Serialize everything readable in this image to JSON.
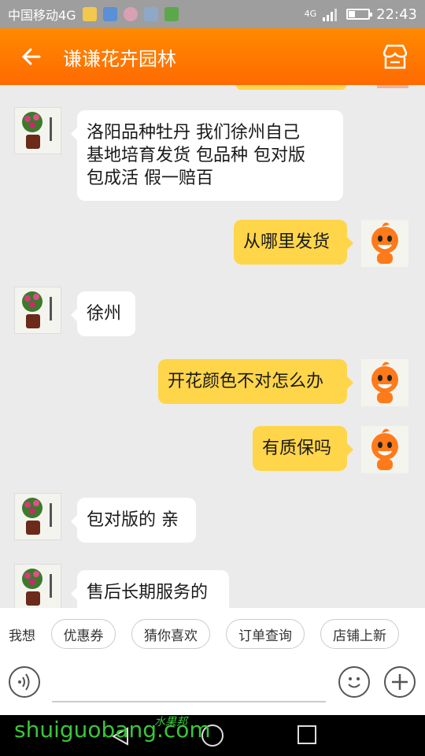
{
  "status": {
    "carrier": "中国移动4G",
    "network": "4G",
    "time": "22:43"
  },
  "header": {
    "title": "谦谦花卉园林"
  },
  "messages": [
    {
      "side": "left",
      "lines": [
        "洛阳品种牡丹  我们徐州自己",
        "基地培育发货  包品种  包对版",
        "包成活   假一赔百"
      ]
    },
    {
      "side": "right",
      "lines": [
        "从哪里发货"
      ]
    },
    {
      "side": "left",
      "lines": [
        "徐州"
      ]
    },
    {
      "side": "right",
      "lines": [
        "开花颜色不对怎么办"
      ]
    },
    {
      "side": "right",
      "lines": [
        "有质保吗"
      ]
    },
    {
      "side": "left",
      "lines": [
        "包对版的 亲"
      ]
    },
    {
      "side": "left",
      "lines": [
        "售后长期服务的"
      ]
    }
  ],
  "quick_reply": {
    "label": "我想",
    "chips": [
      "优惠券",
      "猜你喜欢",
      "订单查询",
      "店铺上新"
    ]
  },
  "watermark": {
    "text": "shuiguobang.com",
    "cn": "水果邦"
  },
  "colors": {
    "accent": "#ff7a00",
    "my_bubble": "#ffd54a"
  }
}
